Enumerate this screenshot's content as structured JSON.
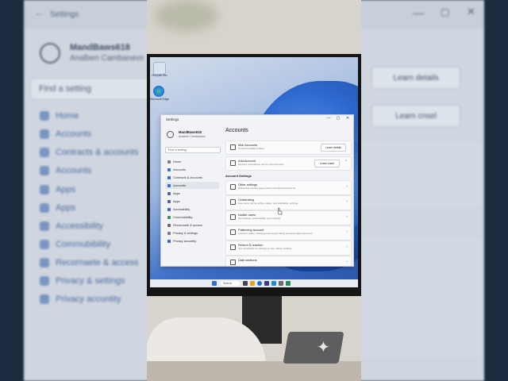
{
  "background_window": {
    "title": "Settings",
    "user_name": "MandBaws618",
    "user_sub": "Analben Cambanave",
    "search_placeholder": "Find a setting",
    "nav_items": [
      "Home",
      "Accounts",
      "Contracts & accounts",
      "Accounts",
      "Apps",
      "Apps",
      "Accessibility",
      "Commubibility",
      "Recornaete & access",
      "Privacy & settings",
      "Privacy accuntity"
    ],
    "right_buttons": [
      "Learn details",
      "Learn cnsel"
    ]
  },
  "desktop": {
    "icons": [
      {
        "label": "Recycle Bin",
        "name": "recycle-bin-icon"
      },
      {
        "label": "Microsoft Edge",
        "name": "edge-icon"
      }
    ]
  },
  "settings": {
    "title": "Settings",
    "user_name": "MandBaws618",
    "user_sub": "Analben Cambanave",
    "search_placeholder": "Find a setting",
    "heading": "Accounts",
    "nav": [
      {
        "label": "Home",
        "icon": "home-icon",
        "color": "#7a7a7a"
      },
      {
        "label": "Accounts",
        "icon": "accounts-icon",
        "color": "#2f6fd1"
      },
      {
        "label": "Contracts & accounts",
        "icon": "contracts-icon",
        "color": "#2f6fd1"
      },
      {
        "label": "Accounts",
        "icon": "accounts-icon",
        "color": "#2f6fd1"
      },
      {
        "label": "Apps",
        "icon": "apps-icon",
        "color": "#5a5a9a"
      },
      {
        "label": "Apps",
        "icon": "apps-icon",
        "color": "#5a5a9a"
      },
      {
        "label": "Accessibility",
        "icon": "accessibility-icon",
        "color": "#2f6fd1"
      },
      {
        "label": "Commubibility",
        "icon": "commubibility-icon",
        "color": "#3a8f5a"
      },
      {
        "label": "Recornaete & access",
        "icon": "recornaete-icon",
        "color": "#6a6a6a"
      },
      {
        "label": "Privacy & settings",
        "icon": "privacy-icon",
        "color": "#7a7a7a"
      },
      {
        "label": "Privacy accuntity",
        "icon": "privacy-accuntity-icon",
        "color": "#2f6fd1"
      }
    ],
    "top_cards": [
      {
        "title": "Mcb Accounts",
        "desc": "Overall exsability anfetal",
        "button": "Learn details",
        "icon": "account-icon"
      },
      {
        "title": "Add Account",
        "desc": "Account, nevershere, sits for your accounts",
        "button": "Learn cnsel",
        "icon": "add-account-icon"
      }
    ],
    "section_title": "Account Settings",
    "cards": [
      {
        "title": "Other settings",
        "desc": "Deliveratte surface page entries extenational accounts",
        "icon": "other-settings-icon"
      },
      {
        "title": "Celebrating",
        "desc": "Use users, sentry, active, states, and assistable, settings",
        "icon": "celebrating-icon"
      },
      {
        "title": "Nodde users",
        "desc": "Get settings, automatiably, your settings",
        "icon": "nodde-users-icon"
      },
      {
        "title": "Patteming account",
        "desc": "Leaveton ration, rebeat peruse engenmating and accumated accounts",
        "icon": "patteming-icon"
      },
      {
        "title": "Reform & reaction",
        "desc": "Use associable for settings on use, shime, settings",
        "icon": "reform-icon"
      },
      {
        "title": "Date sections",
        "desc": "",
        "icon": "date-icon"
      }
    ]
  },
  "taskbar": {
    "search_label": "Search",
    "icons": [
      "start-icon",
      "search-icon",
      "task-view-icon",
      "widgets-icon",
      "file-explorer-icon",
      "edge-icon",
      "store-icon",
      "mail-icon",
      "settings-icon"
    ]
  }
}
